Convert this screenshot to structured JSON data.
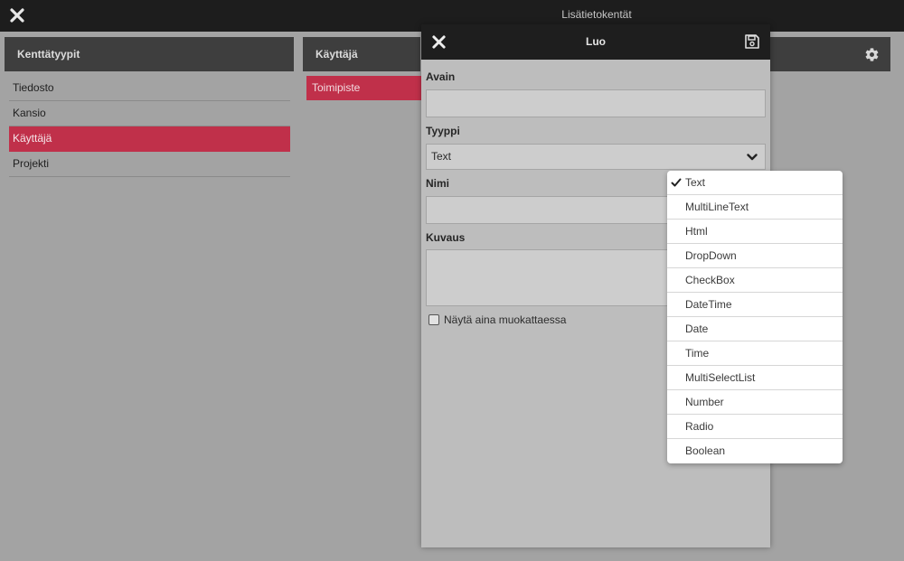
{
  "app": {
    "title": "Lisätietokentät",
    "close_icon": "close-icon"
  },
  "left_panel": {
    "header": "Kenttätyypit",
    "items": [
      {
        "label": "Tiedosto",
        "selected": false
      },
      {
        "label": "Kansio",
        "selected": false
      },
      {
        "label": "Käyttäjä",
        "selected": true
      },
      {
        "label": "Projekti",
        "selected": false
      }
    ]
  },
  "middle_panel": {
    "header": "Käyttäjä",
    "items": [
      {
        "label": "Toimipiste",
        "selected": true
      }
    ]
  },
  "right_panel": {
    "settings_icon": "gear-icon"
  },
  "dialog": {
    "title": "Luo",
    "close_icon": "close-icon",
    "save_icon": "save-icon",
    "fields": {
      "key_label": "Avain",
      "key_value": "",
      "type_label": "Tyyppi",
      "type_value": "Text",
      "name_label": "Nimi",
      "name_value": "",
      "description_label": "Kuvaus",
      "description_value": ""
    },
    "checkbox": {
      "label": "Näytä aina muokattaessa",
      "checked": false
    }
  },
  "type_dropdown": {
    "selected": "Text",
    "options": [
      "Text",
      "MultiLineText",
      "Html",
      "DropDown",
      "CheckBox",
      "DateTime",
      "Date",
      "Time",
      "MultiSelectList",
      "Number",
      "Radio",
      "Boolean"
    ]
  },
  "colors": {
    "accent": "#c0304a",
    "topbar": "#1d1d1d",
    "panel_header": "#3e3e3e",
    "background": "#a3a3a3"
  }
}
